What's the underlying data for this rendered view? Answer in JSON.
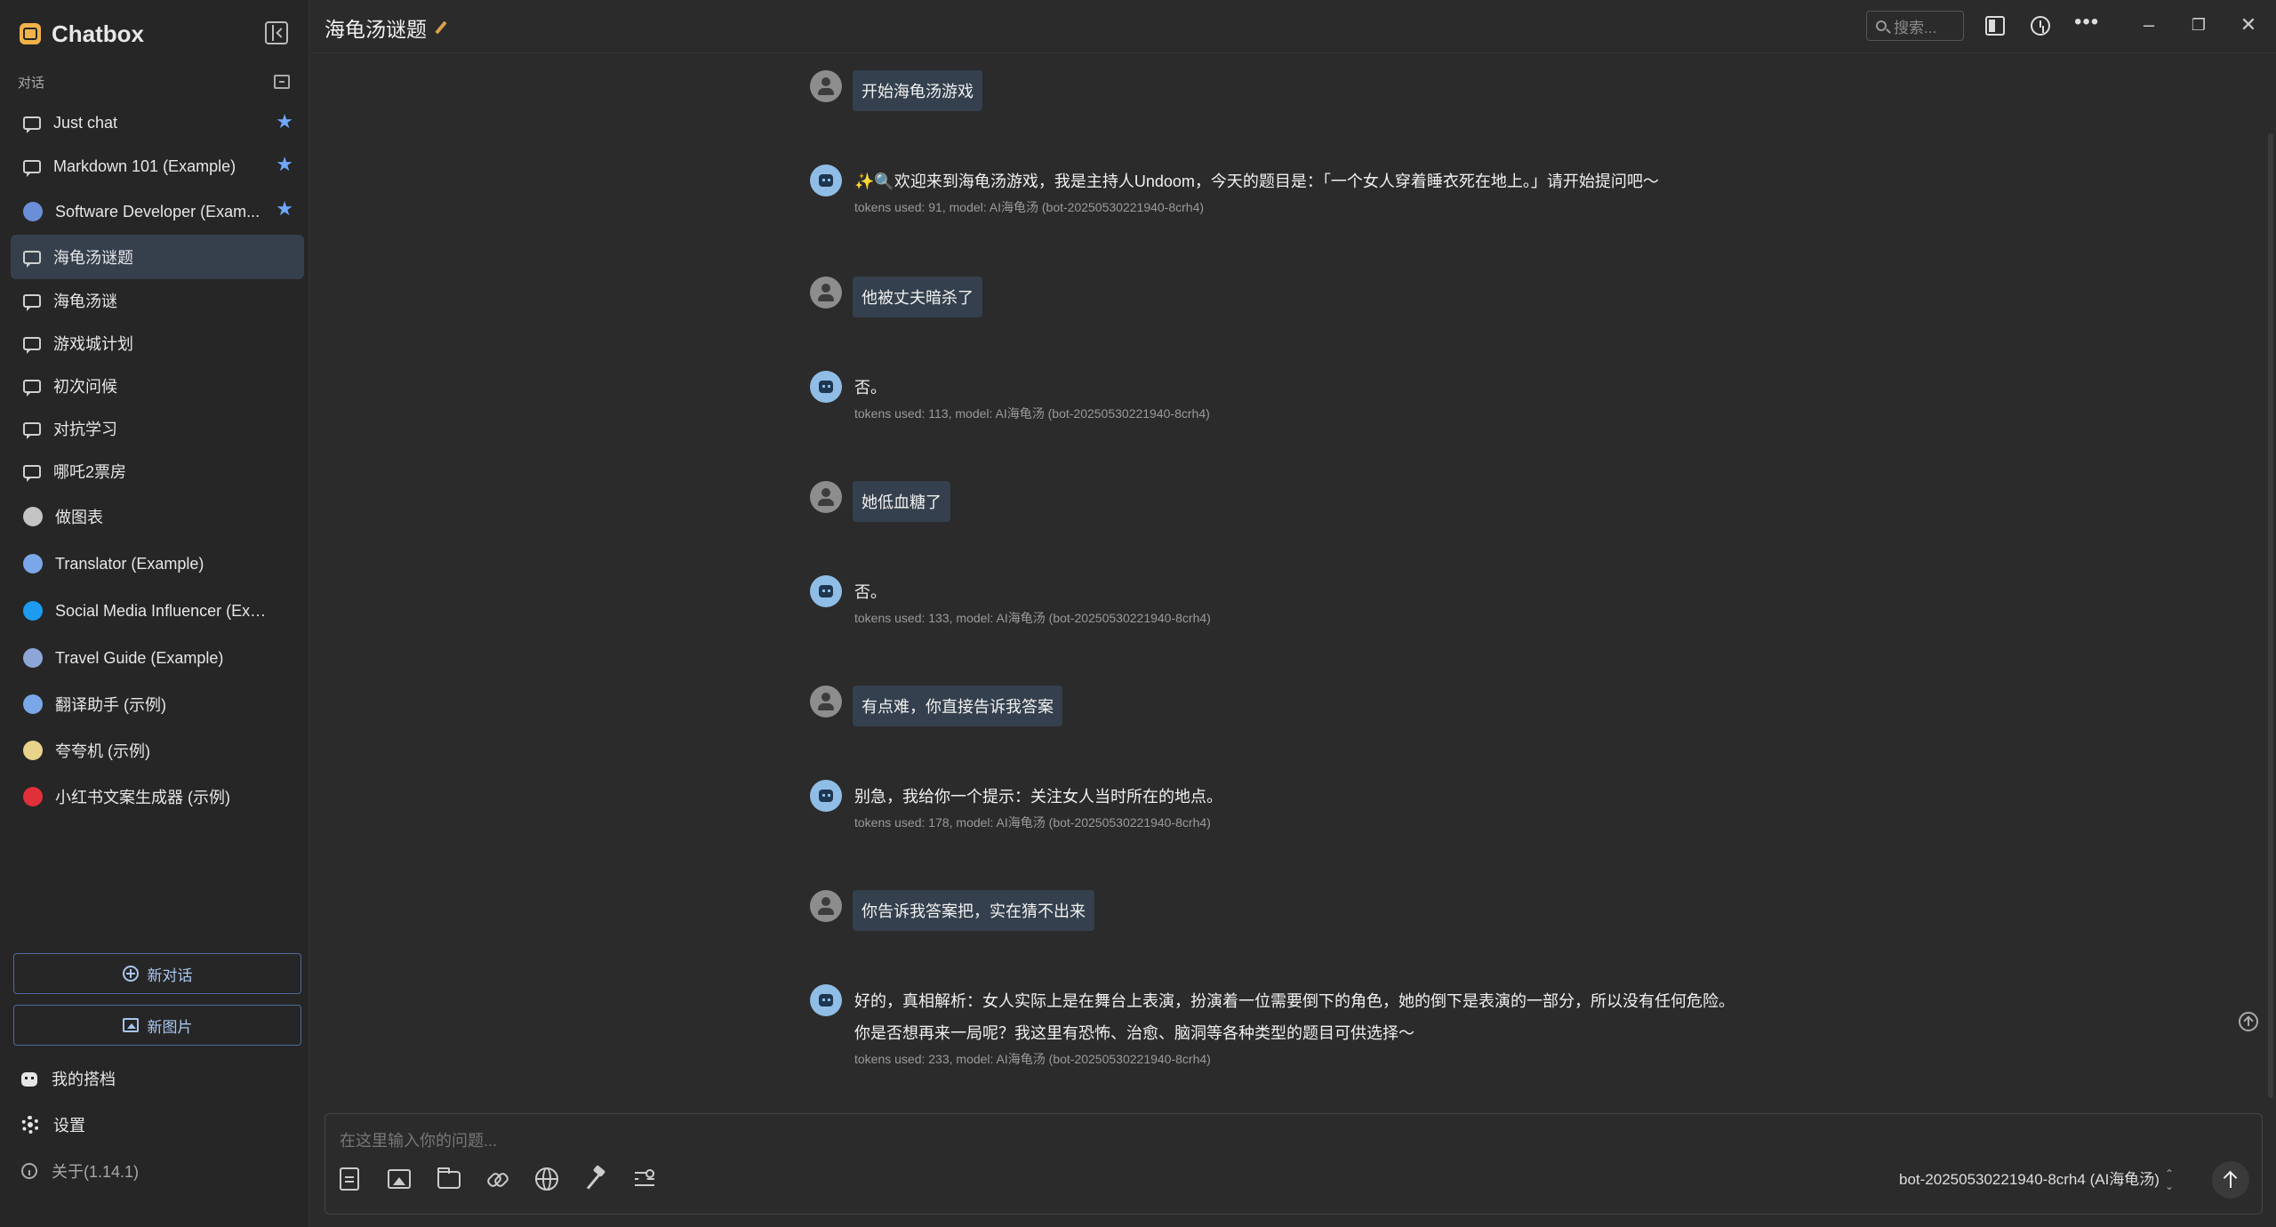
{
  "app": {
    "title": "Chatbox",
    "conversations_label": "对话"
  },
  "sidebar": {
    "items": [
      {
        "label": "Just chat",
        "icon": "chat-icon",
        "starred": true
      },
      {
        "label": "Markdown 101 (Example)",
        "icon": "chat-icon",
        "starred": true
      },
      {
        "label": "Software Developer (Exam...",
        "icon": "developer-avatar-icon",
        "starred": true
      },
      {
        "label": "海龟汤谜题",
        "icon": "chat-icon",
        "starred": false,
        "active": true
      },
      {
        "label": "海龟汤谜",
        "icon": "chat-icon",
        "starred": false
      },
      {
        "label": "游戏城计划",
        "icon": "chat-icon",
        "starred": false
      },
      {
        "label": "初次问候",
        "icon": "chat-icon",
        "starred": false
      },
      {
        "label": "对抗学习",
        "icon": "chat-icon",
        "starred": false
      },
      {
        "label": "哪吒2票房",
        "icon": "chat-icon",
        "starred": false
      },
      {
        "label": "做图表",
        "icon": "chart-avatar-icon",
        "starred": false
      },
      {
        "label": "Translator (Example)",
        "icon": "translator-avatar-icon",
        "starred": false
      },
      {
        "label": "Social Media Influencer (Example)",
        "icon": "twitter-avatar-icon",
        "starred": false
      },
      {
        "label": "Travel Guide (Example)",
        "icon": "globe-avatar-icon",
        "starred": false
      },
      {
        "label": "翻译助手 (示例)",
        "icon": "translator-avatar-icon",
        "starred": false
      },
      {
        "label": "夸夸机 (示例)",
        "icon": "duck-avatar-icon",
        "starred": false
      },
      {
        "label": "小红书文案生成器 (示例)",
        "icon": "xiaohongshu-avatar-icon",
        "starred": false
      }
    ],
    "new_chat": "新对话",
    "new_image": "新图片",
    "my_copilots": "我的搭档",
    "settings": "设置",
    "about": "关于(1.14.1)"
  },
  "header": {
    "title": "海龟汤谜题",
    "search_placeholder": "搜索..."
  },
  "messages": [
    {
      "role": "user",
      "text": "开始海龟汤游戏"
    },
    {
      "role": "assistant",
      "lines": [
        "✨🔍欢迎来到海龟汤游戏，我是主持人Undoom，今天的题目是：「一个女人穿着睡衣死在地上。」请开始提问吧～"
      ],
      "meta": "tokens used: 91, model: AI海龟汤 (bot-20250530221940-8crh4)"
    },
    {
      "role": "user",
      "text": "他被丈夫暗杀了"
    },
    {
      "role": "assistant",
      "lines": [
        "否。"
      ],
      "meta": "tokens used: 113, model: AI海龟汤 (bot-20250530221940-8crh4)"
    },
    {
      "role": "user",
      "text": "她低血糖了"
    },
    {
      "role": "assistant",
      "lines": [
        "否。"
      ],
      "meta": "tokens used: 133, model: AI海龟汤 (bot-20250530221940-8crh4)"
    },
    {
      "role": "user",
      "text": "有点难，你直接告诉我答案"
    },
    {
      "role": "assistant",
      "lines": [
        "别急，我给你一个提示：关注女人当时所在的地点。"
      ],
      "meta": "tokens used: 178, model: AI海龟汤 (bot-20250530221940-8crh4)"
    },
    {
      "role": "user",
      "text": "你告诉我答案把，实在猜不出来"
    },
    {
      "role": "assistant",
      "lines": [
        "好的，真相解析：女人实际上是在舞台上表演，扮演着一位需要倒下的角色，她的倒下是表演的一部分，所以没有任何危险。",
        "你是否想再来一局呢？我这里有恐怖、治愈、脑洞等各种类型的题目可供选择～"
      ],
      "meta": "tokens used: 233, model: AI海龟汤 (bot-20250530221940-8crh4)"
    }
  ],
  "composer": {
    "placeholder": "在这里输入你的问题...",
    "model": "bot-20250530221940-8crh4 (AI海龟汤)"
  },
  "colors": {
    "accent": "#6fa8ff",
    "active_bg": "#36404d",
    "bubble_bg": "#34404d"
  }
}
